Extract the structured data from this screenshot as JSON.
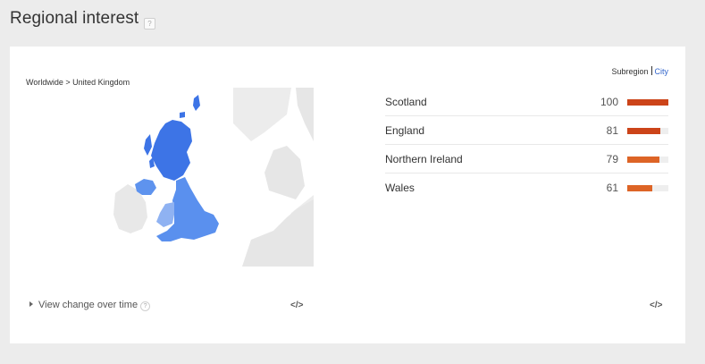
{
  "header": {
    "title": "Regional interest",
    "help_glyph": "?"
  },
  "card": {
    "breadcrumb": "Worldwide > United Kingdom",
    "toggle": {
      "subregion": "Subregion",
      "city": "City"
    },
    "rows": [
      {
        "name": "Scotland",
        "value": "100",
        "fraction": 1.0,
        "color": "#cc4419"
      },
      {
        "name": "England",
        "value": "81",
        "fraction": 0.81,
        "color": "#cc4419"
      },
      {
        "name": "Northern Ireland",
        "value": "79",
        "fraction": 0.79,
        "color": "#dd6426"
      },
      {
        "name": "Wales",
        "value": "61",
        "fraction": 0.61,
        "color": "#dd6426"
      }
    ],
    "view_change": "View change over time",
    "help_glyph": "?",
    "embed_label": "</>",
    "map_colors": {
      "scotland": "#3d74e6",
      "england": "#5a90ee",
      "northern_ireland": "#5e93ee",
      "wales": "#8fb2f2",
      "land": "#e4e4e4",
      "sea": "#ffffff"
    }
  }
}
